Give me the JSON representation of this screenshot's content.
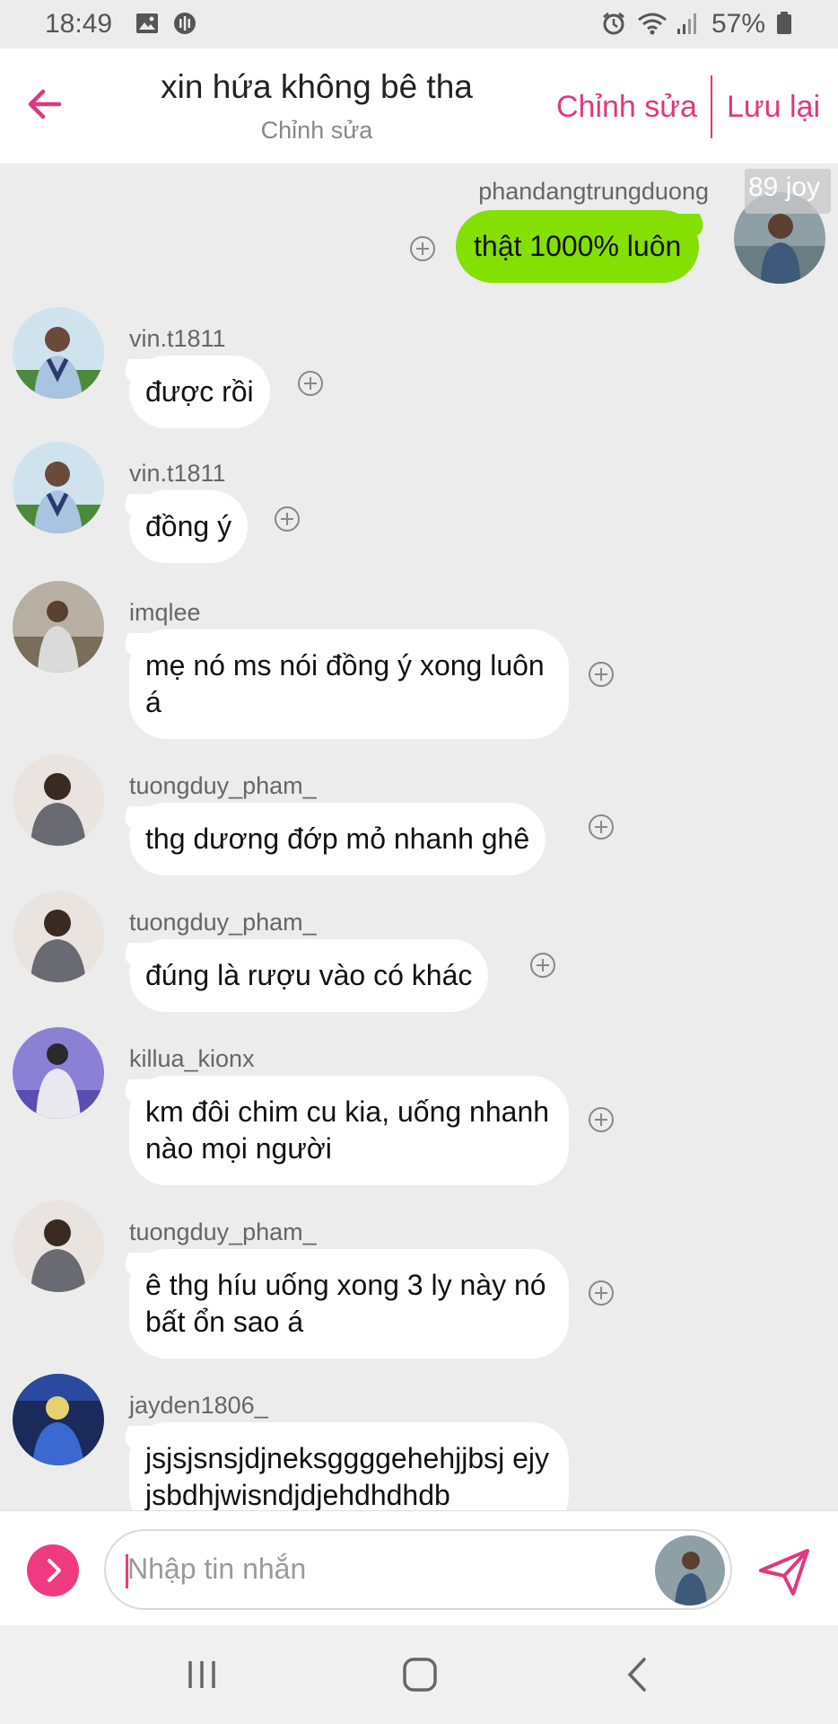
{
  "status_bar": {
    "time": "18:49",
    "battery": "57%"
  },
  "header": {
    "title": "xin hứa không bê tha",
    "subtitle": "Chỉnh sửa",
    "edit_label": "Chỉnh sửa",
    "save_label": "Lưu lại"
  },
  "messages": [
    {
      "username": "phandangtrungduong",
      "text": "thật 1000% luôn",
      "outgoing": true,
      "badge": "89 joy"
    },
    {
      "username": "vin.t1811",
      "text": "được rồi"
    },
    {
      "username": "vin.t1811",
      "text": "đồng ý"
    },
    {
      "username": "imqlee",
      "text": "mẹ nó ms nói đồng ý xong luôn á"
    },
    {
      "username": "tuongduy_pham_",
      "text": "thg dương đớp mỏ nhanh ghê"
    },
    {
      "username": "tuongduy_pham_",
      "text": "đúng là rượu vào có khác"
    },
    {
      "username": "killua_kionx",
      "text": "km đôi chim cu kia, uống nhanh nào mọi người"
    },
    {
      "username": "tuongduy_pham_",
      "text": "ê thg híu uống xong 3 ly này nó bất ổn sao á"
    },
    {
      "username": "jayden1806_",
      "text": "jsjsjsnsjdjneksggggehehjjbsj ejyjsbdhjwisndjdjehdhdhdb"
    }
  ],
  "input": {
    "placeholder": "Nhập tin nhắn"
  },
  "colors": {
    "accent": "#e0387e",
    "outgoing_bubble": "#84e000",
    "background": "#ececec"
  },
  "icons": [
    "back-arrow-icon",
    "add-reaction-icon",
    "chevron-right-icon",
    "send-icon",
    "recent-apps-icon",
    "home-icon",
    "nav-back-icon"
  ]
}
